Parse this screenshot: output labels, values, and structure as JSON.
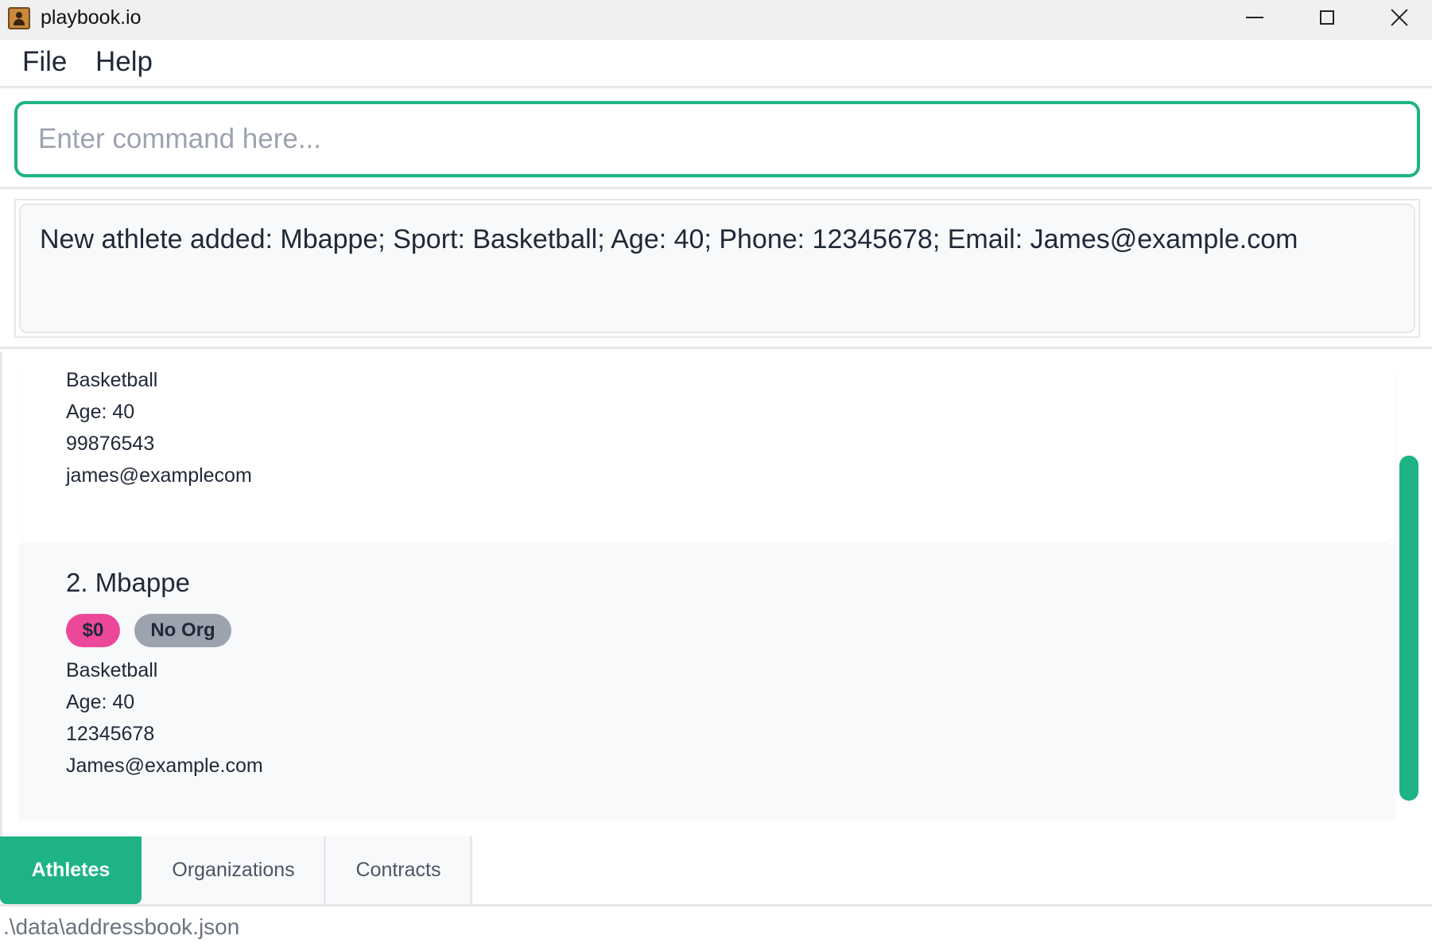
{
  "window": {
    "title": "playbook.io"
  },
  "menu": {
    "items": [
      "File",
      "Help"
    ]
  },
  "command": {
    "value": "",
    "placeholder": "Enter command here..."
  },
  "result": {
    "text": "New athlete added: Mbappe; Sport: Basketball; Age: 40; Phone: 12345678; Email: James@example.com"
  },
  "athletes": [
    {
      "sport": "Basketball",
      "age": "Age: 40",
      "phone": "99876543",
      "email": "james@examplecom"
    },
    {
      "title": "2. Mbappe",
      "badges": [
        "$0",
        "No Org"
      ],
      "sport": "Basketball",
      "age": "Age: 40",
      "phone": "12345678",
      "email": "James@example.com"
    }
  ],
  "tabs": [
    "Athletes",
    "Organizations",
    "Contracts"
  ],
  "status": {
    "path": ".\\data\\addressbook.json"
  },
  "colors": {
    "accent": "#1db385",
    "badge_money": "#ec4899",
    "badge_org": "#9ca3af"
  }
}
